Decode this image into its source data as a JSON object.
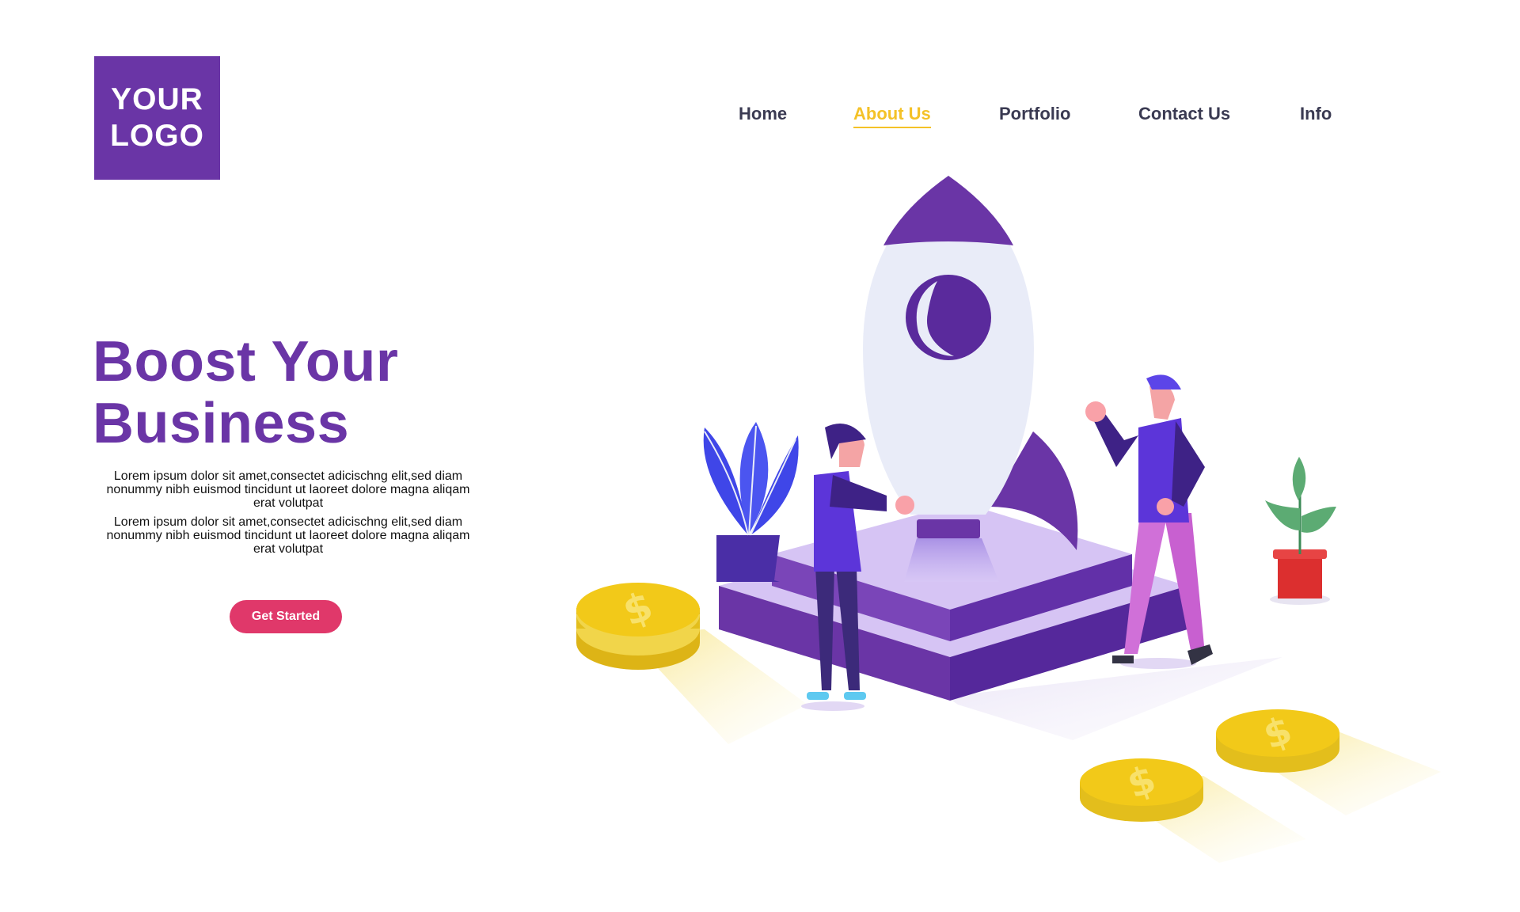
{
  "logo": {
    "line1": "YOUR",
    "line2": "LOGO"
  },
  "nav": {
    "items": [
      {
        "label": "Home"
      },
      {
        "label": "About Us"
      },
      {
        "label": "Portfolio"
      },
      {
        "label": "Contact Us"
      },
      {
        "label": "Info"
      }
    ],
    "active": "About Us"
  },
  "hero": {
    "title_line1": "Boost Your",
    "title_line2": "Business",
    "paragraph1": "Lorem ipsum dolor sit amet,consectet adicischng elit,sed diam nonummy nibh euismod tincidunt ut laoreet dolore magna aliqam erat volutpat",
    "paragraph2": "Lorem ipsum dolor sit amet,consectet adicischng elit,sed diam nonummy nibh euismod tincidunt ut laoreet dolore magna aliqam erat volutpat",
    "cta_label": "Get Started"
  },
  "coin_symbol": "$",
  "colors": {
    "primary": "#6a35a6",
    "accent": "#f4c228",
    "cta": "#e0386a",
    "nav_text": "#3a3a52"
  }
}
